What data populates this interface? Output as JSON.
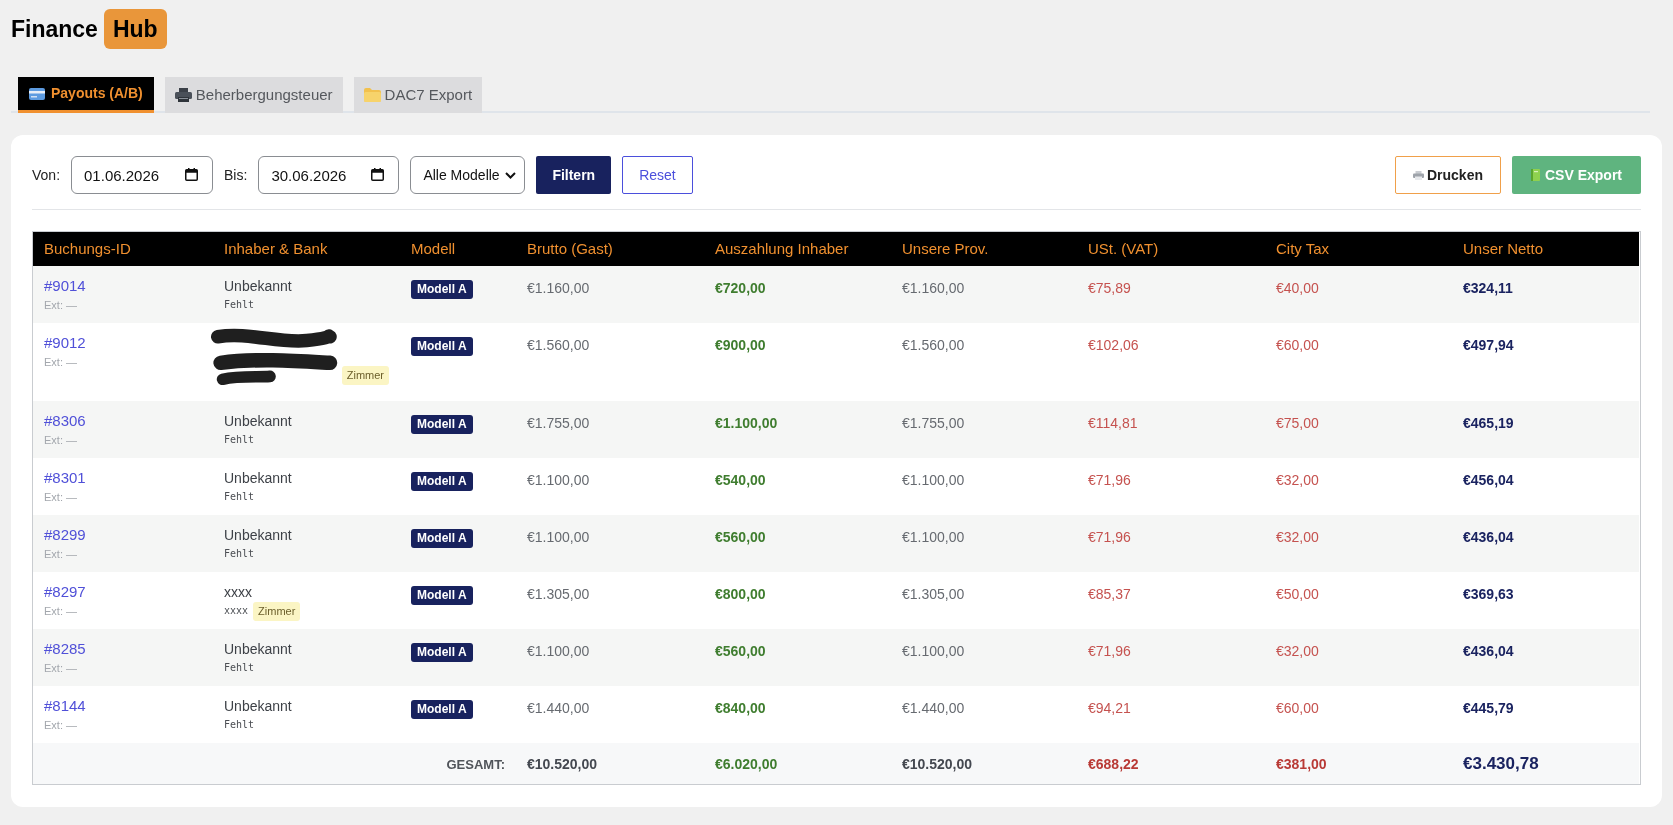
{
  "logo": {
    "text": "Finance",
    "badge": "Hub"
  },
  "tabs": [
    {
      "label": "Payouts (A/B)",
      "selected": true
    },
    {
      "label": "Beherbergungsteuer",
      "selected": false
    },
    {
      "label": "DAC7 Export",
      "selected": false
    }
  ],
  "filters": {
    "from_label": "Von:",
    "from_value": "01.06.2026",
    "to_label": "Bis:",
    "to_value": "30.06.2026",
    "model_select": "Alle Modelle",
    "buttons": [
      {
        "label": "Filtern",
        "kind": "primary"
      },
      {
        "label": "Reset",
        "kind": "outline"
      }
    ]
  },
  "actions": [
    {
      "label": "Drucken",
      "kind": "outline"
    },
    {
      "label": "CSV Export",
      "kind": "success"
    }
  ],
  "table": {
    "columns": [
      "Buchungs-ID",
      "Inhaber & Bank",
      "Modell",
      "Brutto (Gast)",
      "Auszahlung Inhaber",
      "Unsere Prov.",
      "USt. (VAT)",
      "City Tax",
      "Unser Netto"
    ],
    "rows": [
      {
        "id": "#9014",
        "ext": "Ext: —",
        "owner": {
          "redacted": false,
          "name": "Unbekannt",
          "bank": "Fehlt"
        },
        "model": "Modell A",
        "gross": "€1.160,00",
        "payout": "€720,00",
        "commission": "€1.160,00",
        "vat": "€75,89",
        "city_tax": "€40,00",
        "net": "€324,11"
      },
      {
        "id": "#9012",
        "ext": "Ext: —",
        "owner": {
          "redacted": true,
          "tag": "Zimmer"
        },
        "model": "Modell A",
        "gross": "€1.560,00",
        "payout": "€900,00",
        "commission": "€1.560,00",
        "vat": "€102,06",
        "city_tax": "€60,00",
        "net": "€497,94"
      },
      {
        "id": "#8306",
        "ext": "Ext: —",
        "owner": {
          "redacted": false,
          "name": "Unbekannt",
          "bank": "Fehlt"
        },
        "model": "Modell A",
        "gross": "€1.755,00",
        "payout": "€1.100,00",
        "commission": "€1.755,00",
        "vat": "€114,81",
        "city_tax": "€75,00",
        "net": "€465,19"
      },
      {
        "id": "#8301",
        "ext": "Ext: —",
        "owner": {
          "redacted": false,
          "name": "Unbekannt",
          "bank": "Fehlt"
        },
        "model": "Modell A",
        "gross": "€1.100,00",
        "payout": "€540,00",
        "commission": "€1.100,00",
        "vat": "€71,96",
        "city_tax": "€32,00",
        "net": "€456,04"
      },
      {
        "id": "#8299",
        "ext": "Ext: —",
        "owner": {
          "redacted": false,
          "name": "Unbekannt",
          "bank": "Fehlt"
        },
        "model": "Modell A",
        "gross": "€1.100,00",
        "payout": "€560,00",
        "commission": "€1.100,00",
        "vat": "€71,96",
        "city_tax": "€32,00",
        "net": "€436,04"
      },
      {
        "id": "#8297",
        "ext": "Ext: —",
        "owner": {
          "redacted": false,
          "name": "xxxx",
          "bank": "xxxx",
          "tag": "Zimmer"
        },
        "model": "Modell A",
        "gross": "€1.305,00",
        "payout": "€800,00",
        "commission": "€1.305,00",
        "vat": "€85,37",
        "city_tax": "€50,00",
        "net": "€369,63"
      },
      {
        "id": "#8285",
        "ext": "Ext: —",
        "owner": {
          "redacted": false,
          "name": "Unbekannt",
          "bank": "Fehlt"
        },
        "model": "Modell A",
        "gross": "€1.100,00",
        "payout": "€560,00",
        "commission": "€1.100,00",
        "vat": "€71,96",
        "city_tax": "€32,00",
        "net": "€436,04"
      },
      {
        "id": "#8144",
        "ext": "Ext: —",
        "owner": {
          "redacted": false,
          "name": "Unbekannt",
          "bank": "Fehlt"
        },
        "model": "Modell A",
        "gross": "€1.440,00",
        "payout": "€840,00",
        "commission": "€1.440,00",
        "vat": "€94,21",
        "city_tax": "€60,00",
        "net": "€445,79"
      }
    ],
    "totals": {
      "label": "GESAMT:",
      "gross": "€10.520,00",
      "payout": "€6.020,00",
      "commission": "€10.520,00",
      "vat": "€688,22",
      "city_tax": "€381,00",
      "net": "€3.430,78"
    }
  }
}
